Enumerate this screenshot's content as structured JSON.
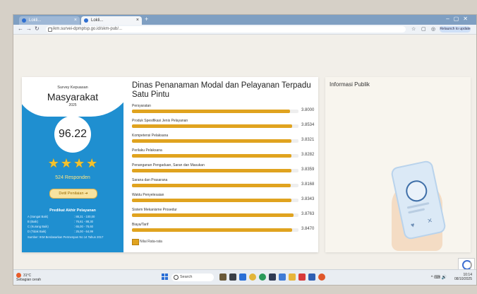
{
  "browser": {
    "tabs": [
      {
        "label": "Lokli..."
      },
      {
        "label": "Lokli..."
      }
    ],
    "url": "ikm.survei-dpmptsp.go.id/skm-pub/...",
    "profile_label": "Relaunch to update"
  },
  "survey": {
    "subtitle": "Survey Kepuasan",
    "title": "Masyarakat",
    "year": "2025",
    "score": "96.22",
    "stars": 4,
    "respondents": "524 Responden",
    "detail_button": "Detil Penilaian",
    "predicate_title": "Predikat Akhir Pelayanan",
    "predicates": [
      {
        "label": "A (Sangat Baik)",
        "range": ": 88,31 - 100,00"
      },
      {
        "label": "B (Baik)",
        "range": ": 76,61 - 88,30"
      },
      {
        "label": "C (Kurang Baik)",
        "range": ": 65,00 - 76,60"
      },
      {
        "label": "D (Tidak Baik)",
        "range": ": 25,00 - 64,99"
      }
    ],
    "predicate_note": "Sumber: IKM Berdasarkan Permenpan No 14 Tahun 2017"
  },
  "org": {
    "title": "Dinas Penanaman Modal dan Pelayanan Terpadu Satu Pintu"
  },
  "criteria": [
    {
      "label": "Persyaratan",
      "value": "3.8000",
      "fraction": 0.95
    },
    {
      "label": "Produk Spesifikasi Jenis Pelayanan",
      "value": "3.8534",
      "fraction": 0.963
    },
    {
      "label": "Kompetensi Pelaksana",
      "value": "3.8321",
      "fraction": 0.958
    },
    {
      "label": "Perilaku Pelaksana",
      "value": "3.8282",
      "fraction": 0.957
    },
    {
      "label": "Penanganan Pengaduan, Saran dan Masukan",
      "value": "3.8359",
      "fraction": 0.959
    },
    {
      "label": "Sarana dan Prasarana",
      "value": "3.8168",
      "fraction": 0.954
    },
    {
      "label": "Waktu Penyelesaian",
      "value": "3.8343",
      "fraction": 0.958
    },
    {
      "label": "Sistem Mekanisme Prosedur",
      "value": "3.8763",
      "fraction": 0.969
    },
    {
      "label": "Biaya/Tarif",
      "value": "3.8470",
      "fraction": 0.962
    }
  ],
  "legend_label": "Nilai Rata-rata",
  "info": {
    "title": "Informasi Publik"
  },
  "taskbar": {
    "weather_temp": "31°C",
    "weather_desc": "Sebagian cerah",
    "search_label": "Search",
    "tray_icons": "^ ⌨ 🔊",
    "time": "10:14",
    "date": "08/10/2025"
  },
  "colors": {
    "accent_blue": "#1f8fd0",
    "bar": "#e0a31f",
    "star": "#f2c22e"
  }
}
